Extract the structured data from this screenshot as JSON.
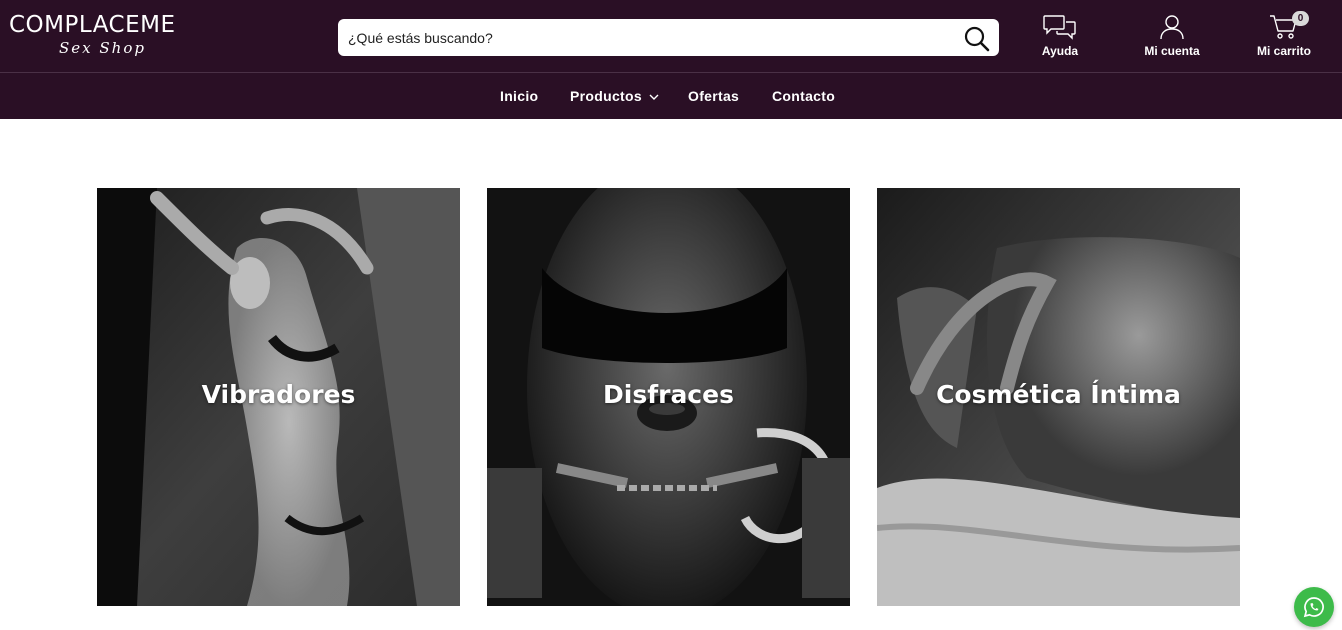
{
  "brand": {
    "name": "COMPLACEME",
    "tagline": "Sex Shop"
  },
  "search": {
    "placeholder": "¿Qué estás buscando?"
  },
  "header_actions": {
    "help": "Ayuda",
    "account": "Mi cuenta",
    "cart": "Mi carrito",
    "cart_count": "0"
  },
  "nav": {
    "items": [
      {
        "label": "Inicio"
      },
      {
        "label": "Productos",
        "has_dropdown": true
      },
      {
        "label": "Ofertas"
      },
      {
        "label": "Contacto"
      }
    ]
  },
  "categories": [
    {
      "label": "Vibradores"
    },
    {
      "label": "Disfraces"
    },
    {
      "label": "Cosmética Íntima"
    }
  ],
  "icons": {
    "search": "search-icon",
    "help": "chat-bubbles-icon",
    "account": "user-icon",
    "cart": "cart-icon",
    "dropdown": "chevron-down-icon",
    "whatsapp": "whatsapp-icon"
  },
  "colors": {
    "header_bg": "#2a0f25",
    "whatsapp": "#3dbb4a",
    "page_bg": "#ffffff"
  }
}
